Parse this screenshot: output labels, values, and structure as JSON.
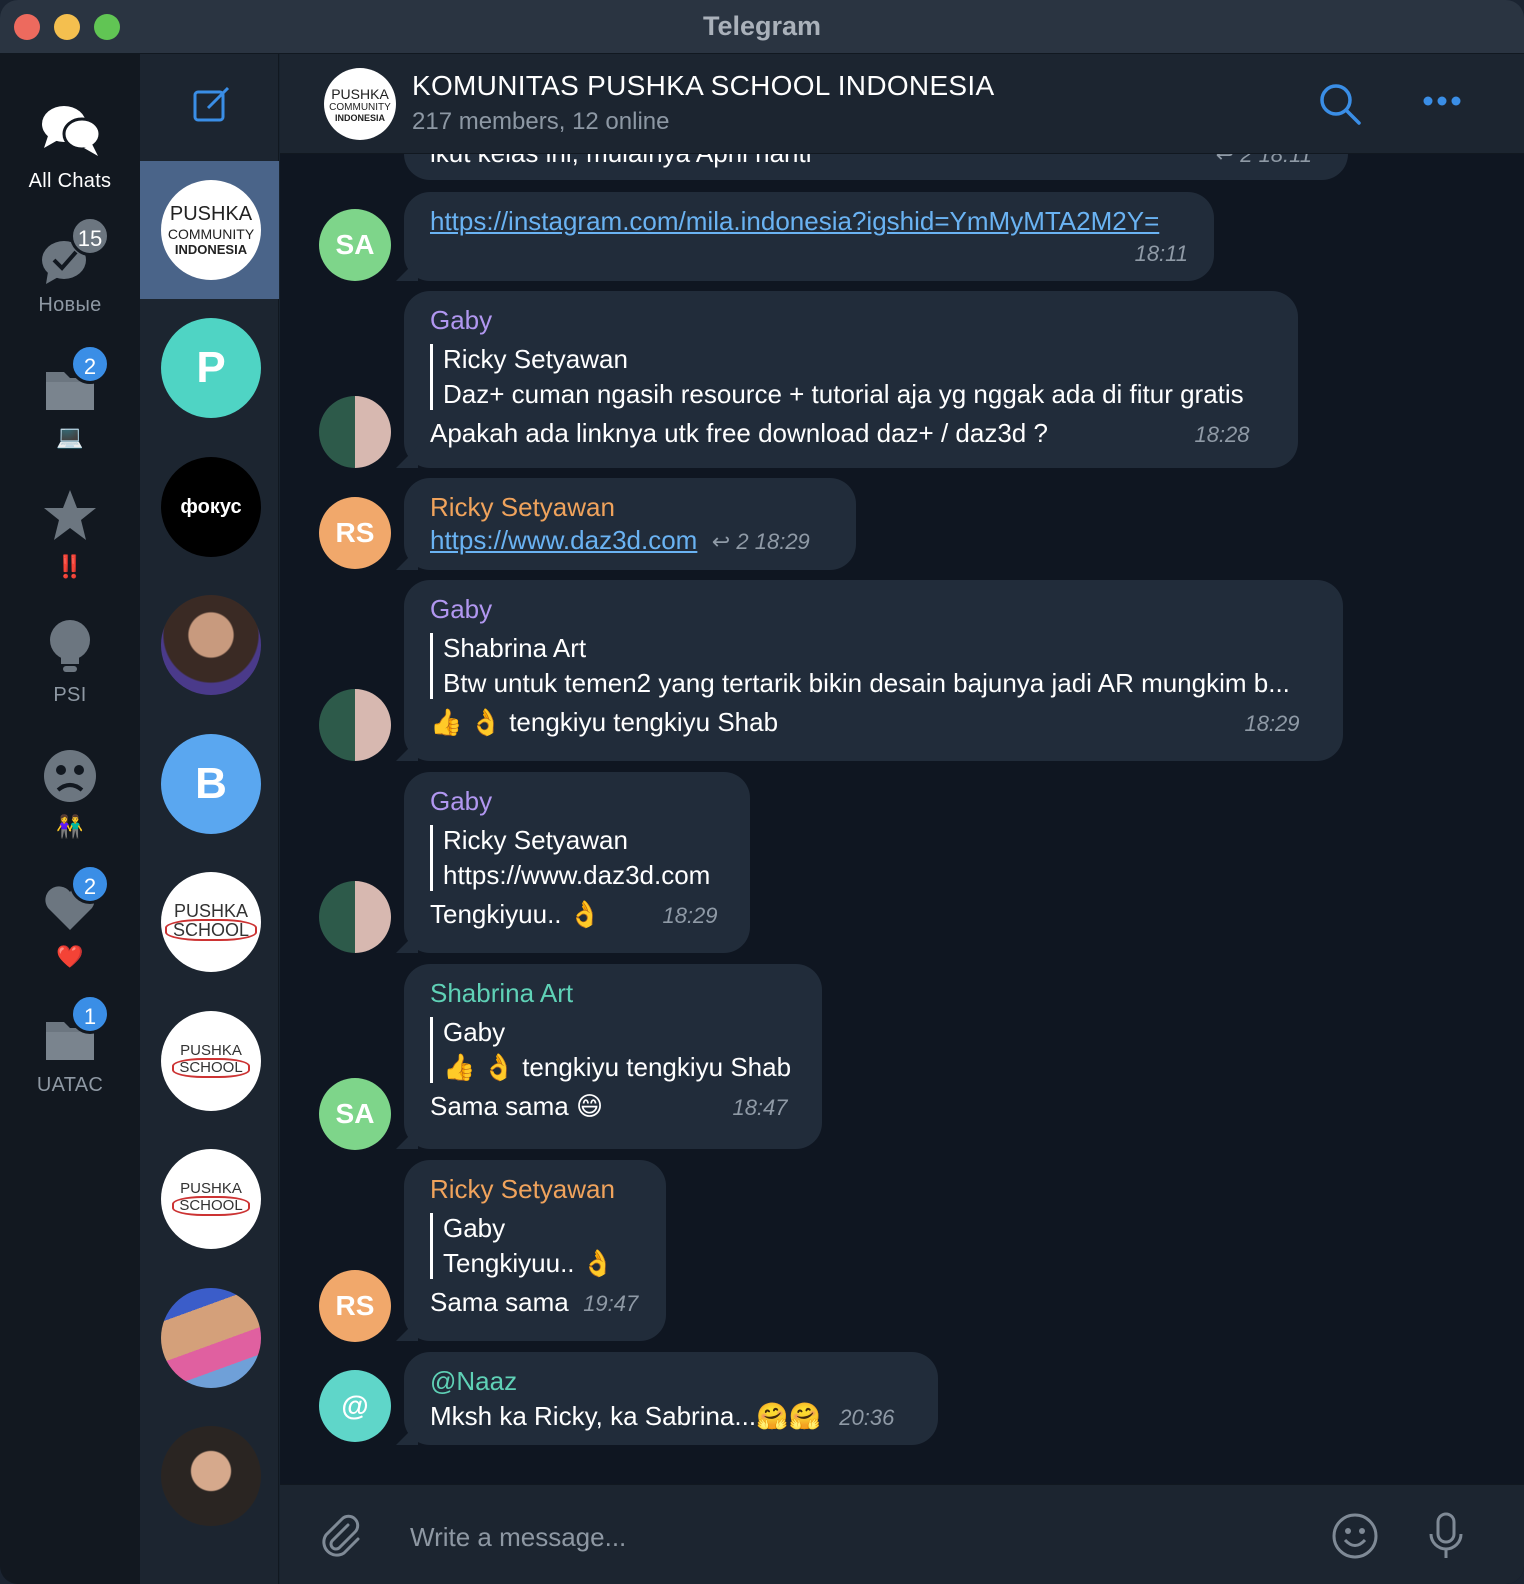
{
  "window": {
    "title": "Telegram"
  },
  "folders": [
    {
      "label": "All Chats",
      "badge": "",
      "icon": "chat-bubbles-icon"
    },
    {
      "label": "Новые",
      "badge": "15",
      "icon": "chat-check-icon"
    },
    {
      "label": "💻",
      "badge": "2",
      "icon": "folder-icon"
    },
    {
      "label": "‼️",
      "badge": "",
      "icon": "star-icon"
    },
    {
      "label": "PSI",
      "badge": "",
      "icon": "lightbulb-icon"
    },
    {
      "label": "👫",
      "badge": "",
      "icon": "sad-face-icon"
    },
    {
      "label": "❤️",
      "badge": "2",
      "icon": "heart-icon"
    },
    {
      "label": "UATAC",
      "badge": "1",
      "icon": "folder-icon"
    }
  ],
  "chatlist": {
    "items": [
      {
        "kind": "pushka-community",
        "lines": [
          "PUSHKA",
          "COMMUNITY",
          "INDONESIA"
        ],
        "selected": true
      },
      {
        "kind": "letter",
        "letter": "P",
        "color": "#4fd4c4"
      },
      {
        "kind": "text",
        "text": "фокус",
        "color": "#000000"
      },
      {
        "kind": "photo",
        "color": "#5a3e36"
      },
      {
        "kind": "letter",
        "letter": "B",
        "color": "#5aa7f0"
      },
      {
        "kind": "pushka-school",
        "lines": [
          "PUSHKA",
          "SCHOOL"
        ]
      },
      {
        "kind": "pushka-school",
        "lines": [
          "PUSHKA",
          "SCHOOL"
        ]
      },
      {
        "kind": "pushka-school",
        "lines": [
          "PUSHKA",
          "SCHOOL"
        ]
      },
      {
        "kind": "photo",
        "color": "#6b7fb0"
      },
      {
        "kind": "photo",
        "color": "#3b3430"
      }
    ]
  },
  "header": {
    "title": "KOMUNITAS PUSHKA SCHOOL INDONESIA",
    "subtitle": "217 members, 12 online",
    "avatar_lines": [
      "PUSHKA",
      "COMMUNITY",
      "INDONESIA"
    ]
  },
  "messages": [
    {
      "cut_text": "ikut kelas ini, mulainya April nanti",
      "cut_meta": "2 18:11"
    },
    {
      "avatar": "SA",
      "avatar_color": "#7ed58a",
      "link": "https://instagram.com/mila.indonesia?igshid=YmMyMTA2M2Y=",
      "time": "18:11"
    },
    {
      "avatar": "photo",
      "sender": "Gaby",
      "sender_color": "#b197f0",
      "reply_name": "Ricky Setyawan",
      "reply_text": "Daz+ cuman ngasih resource + tutorial aja yg nggak ada di fitur gratis",
      "text": "Apakah ada linknya utk free download daz+ / daz3d ?",
      "time": "18:28"
    },
    {
      "avatar": "RS",
      "avatar_color": "#f1a86b",
      "sender": "Ricky Setyawan",
      "sender_color": "#f0a35c",
      "link": "https://www.daz3d.com",
      "replies": "2",
      "time": "18:29"
    },
    {
      "avatar": "photo",
      "sender": "Gaby",
      "sender_color": "#b197f0",
      "reply_name": "Shabrina Art",
      "reply_text": "Btw untuk temen2 yang tertarik bikin desain bajunya jadi AR mungkim b...",
      "text": "👍 👌 tengkiyu tengkiyu Shab",
      "time": "18:29"
    },
    {
      "avatar": "photo",
      "sender": "Gaby",
      "sender_color": "#b197f0",
      "reply_name": "Ricky Setyawan",
      "reply_text": "https://www.daz3d.com",
      "text": "Tengkiyuu.. 👌",
      "time": "18:29"
    },
    {
      "avatar": "SA",
      "avatar_color": "#7ed58a",
      "sender": "Shabrina Art",
      "sender_color": "#5fd1b6",
      "reply_name": "Gaby",
      "reply_text": "👍 👌 tengkiyu tengkiyu Shab",
      "text": "Sama sama 😄",
      "time": "18:47"
    },
    {
      "avatar": "RS",
      "avatar_color": "#f1a86b",
      "sender": "Ricky Setyawan",
      "sender_color": "#f0a35c",
      "reply_name": "Gaby",
      "reply_text": "Tengkiyuu.. 👌",
      "text": "Sama sama",
      "time": "19:47"
    },
    {
      "avatar": "@",
      "avatar_color": "#5fd6c9",
      "sender": "@Naaz",
      "sender_color": "#5fd1b6",
      "text": "Mksh ka Ricky, ka Sabrina...🤗🤗",
      "time": "20:36"
    }
  ],
  "composer": {
    "placeholder": "Write a message..."
  },
  "colors": {
    "accent": "#3a8ee6",
    "bubble": "#212c3a",
    "link": "#6ab3f3"
  }
}
